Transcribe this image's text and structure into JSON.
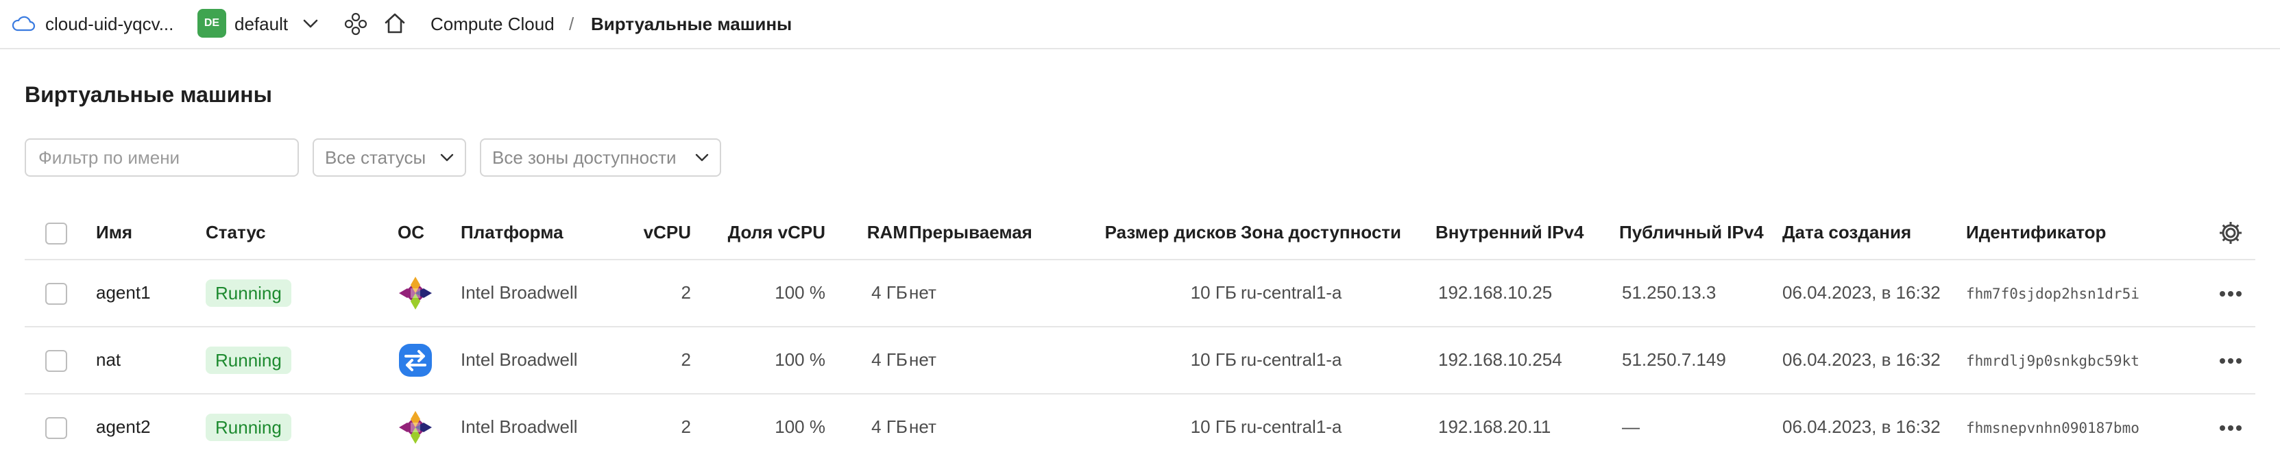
{
  "topbar": {
    "cloud_name": "cloud-uid-yqcv...",
    "folder_badge": "DE",
    "folder_name": "default",
    "breadcrumb": [
      "Compute Cloud",
      "/",
      "Виртуальные машины"
    ]
  },
  "page": {
    "title": "Виртуальные машины"
  },
  "filters": {
    "name_placeholder": "Фильтр по имени",
    "status_select": "Все статусы",
    "zone_select": "Все зоны доступности"
  },
  "table": {
    "headers": {
      "name": "Имя",
      "status": "Статус",
      "os": "ОС",
      "platform": "Платформа",
      "vcpu": "vCPU",
      "vcpu_share": "Доля vCPU",
      "ram": "RAM",
      "preemptible": "Прерываемая",
      "disk_size": "Размер дисков",
      "zone": "Зона доступности",
      "internal_ip": "Внутренний IPv4",
      "public_ip": "Публичный IPv4",
      "created": "Дата создания",
      "id": "Идентификатор"
    },
    "rows": [
      {
        "name": "agent1",
        "status": "Running",
        "os_icon": "centos-icon",
        "platform": "Intel Broadwell",
        "vcpu": "2",
        "vcpu_share": "100 %",
        "ram": "4 ГБ",
        "preemptible": "нет",
        "disk_size": "10 ГБ",
        "zone": "ru-central1-a",
        "internal_ip": "192.168.10.25",
        "public_ip": "51.250.13.3",
        "created": "06.04.2023, в 16:32",
        "id": "fhm7f0sjdop2hsn1dr5i"
      },
      {
        "name": "nat",
        "status": "Running",
        "os_icon": "nat-instance-icon",
        "platform": "Intel Broadwell",
        "vcpu": "2",
        "vcpu_share": "100 %",
        "ram": "4 ГБ",
        "preemptible": "нет",
        "disk_size": "10 ГБ",
        "zone": "ru-central1-a",
        "internal_ip": "192.168.10.254",
        "public_ip": "51.250.7.149",
        "created": "06.04.2023, в 16:32",
        "id": "fhmrdlj9p0snkgbc59kt"
      },
      {
        "name": "agent2",
        "status": "Running",
        "os_icon": "centos-icon",
        "platform": "Intel Broadwell",
        "vcpu": "2",
        "vcpu_share": "100 %",
        "ram": "4 ГБ",
        "preemptible": "нет",
        "disk_size": "10 ГБ",
        "zone": "ru-central1-a",
        "internal_ip": "192.168.20.11",
        "public_ip": "—",
        "created": "06.04.2023, в 16:32",
        "id": "fhmsnepvnhn090187bmo"
      }
    ]
  },
  "colors": {
    "accent_blue": "#3a7be0",
    "folder_badge": "#3fa450",
    "status_bg": "#dff5e2",
    "status_text": "#1d8a2f",
    "divider": "#e6e6e6"
  }
}
